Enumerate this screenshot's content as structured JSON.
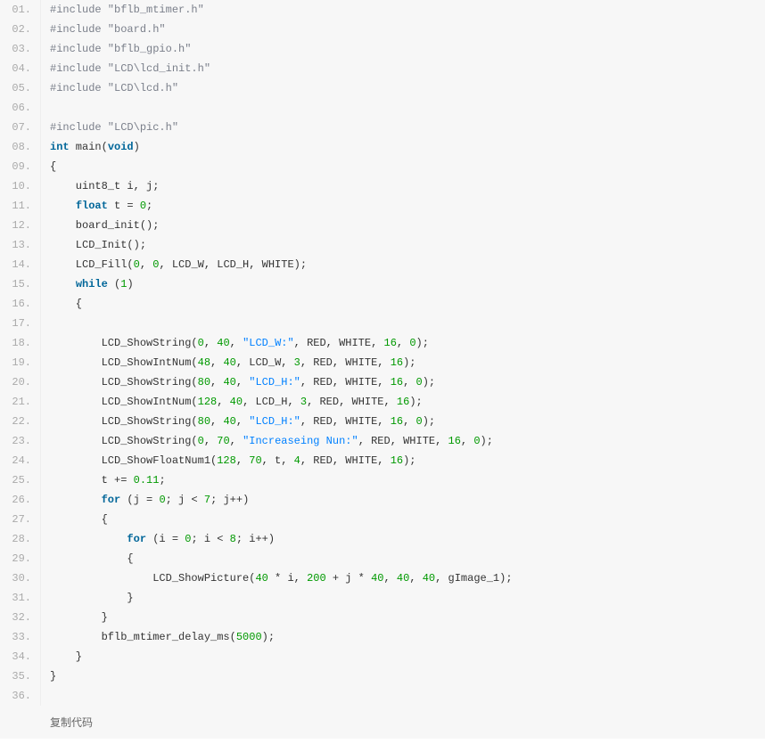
{
  "code": {
    "lines": [
      {
        "num": "01.",
        "html": "<span class='incl'>#include \"bflb_mtimer.h\"</span>"
      },
      {
        "num": "02.",
        "html": "<span class='incl'>#include \"board.h\"</span>"
      },
      {
        "num": "03.",
        "html": "<span class='incl'>#include \"bflb_gpio.h\"</span>"
      },
      {
        "num": "04.",
        "html": "<span class='incl'>#include \"LCD\\lcd_init.h\"</span>"
      },
      {
        "num": "05.",
        "html": "<span class='incl'>#include \"LCD\\lcd.h\"</span>"
      },
      {
        "num": "06.",
        "html": ""
      },
      {
        "num": "07.",
        "html": "<span class='incl'>#include \"LCD\\pic.h\"</span>"
      },
      {
        "num": "08.",
        "html": "<span class='kw'>int</span> main(<span class='kw'>void</span>)"
      },
      {
        "num": "09.",
        "html": "{"
      },
      {
        "num": "10.",
        "html": "    uint8_t i, j;"
      },
      {
        "num": "11.",
        "html": "    <span class='kw'>float</span> t = <span class='num'>0</span>;"
      },
      {
        "num": "12.",
        "html": "    board_init();"
      },
      {
        "num": "13.",
        "html": "    LCD_Init();"
      },
      {
        "num": "14.",
        "html": "    LCD_Fill(<span class='num'>0</span>, <span class='num'>0</span>, LCD_W, LCD_H, WHITE);"
      },
      {
        "num": "15.",
        "html": "    <span class='kw'>while</span> (<span class='num'>1</span>)"
      },
      {
        "num": "16.",
        "html": "    {"
      },
      {
        "num": "17.",
        "html": ""
      },
      {
        "num": "18.",
        "html": "        LCD_ShowString(<span class='num'>0</span>, <span class='num'>40</span>, <span class='str'>\"LCD_W:\"</span>, RED, WHITE, <span class='num'>16</span>, <span class='num'>0</span>);"
      },
      {
        "num": "19.",
        "html": "        LCD_ShowIntNum(<span class='num'>48</span>, <span class='num'>40</span>, LCD_W, <span class='num'>3</span>, RED, WHITE, <span class='num'>16</span>);"
      },
      {
        "num": "20.",
        "html": "        LCD_ShowString(<span class='num'>80</span>, <span class='num'>40</span>, <span class='str'>\"LCD_H:\"</span>, RED, WHITE, <span class='num'>16</span>, <span class='num'>0</span>);"
      },
      {
        "num": "21.",
        "html": "        LCD_ShowIntNum(<span class='num'>128</span>, <span class='num'>40</span>, LCD_H, <span class='num'>3</span>, RED, WHITE, <span class='num'>16</span>);"
      },
      {
        "num": "22.",
        "html": "        LCD_ShowString(<span class='num'>80</span>, <span class='num'>40</span>, <span class='str'>\"LCD_H:\"</span>, RED, WHITE, <span class='num'>16</span>, <span class='num'>0</span>);"
      },
      {
        "num": "23.",
        "html": "        LCD_ShowString(<span class='num'>0</span>, <span class='num'>70</span>, <span class='str'>\"Increaseing Nun:\"</span>, RED, WHITE, <span class='num'>16</span>, <span class='num'>0</span>);"
      },
      {
        "num": "24.",
        "html": "        LCD_ShowFloatNum1(<span class='num'>128</span>, <span class='num'>70</span>, t, <span class='num'>4</span>, RED, WHITE, <span class='num'>16</span>);"
      },
      {
        "num": "25.",
        "html": "        t += <span class='num'>0.11</span>;"
      },
      {
        "num": "26.",
        "html": "        <span class='kw'>for</span> (j = <span class='num'>0</span>; j &lt; <span class='num'>7</span>; j++)"
      },
      {
        "num": "27.",
        "html": "        {"
      },
      {
        "num": "28.",
        "html": "            <span class='kw'>for</span> (i = <span class='num'>0</span>; i &lt; <span class='num'>8</span>; i++)"
      },
      {
        "num": "29.",
        "html": "            {"
      },
      {
        "num": "30.",
        "html": "                LCD_ShowPicture(<span class='num'>40</span> * i, <span class='num'>200</span> + j * <span class='num'>40</span>, <span class='num'>40</span>, <span class='num'>40</span>, gImage_1);"
      },
      {
        "num": "31.",
        "html": "            }"
      },
      {
        "num": "32.",
        "html": "        }"
      },
      {
        "num": "33.",
        "html": "        bflb_mtimer_delay_ms(<span class='num'>5000</span>);"
      },
      {
        "num": "34.",
        "html": "    }"
      },
      {
        "num": "35.",
        "html": "}"
      },
      {
        "num": "36.",
        "html": ""
      }
    ]
  },
  "actions": {
    "copy_label": "复制代码"
  }
}
